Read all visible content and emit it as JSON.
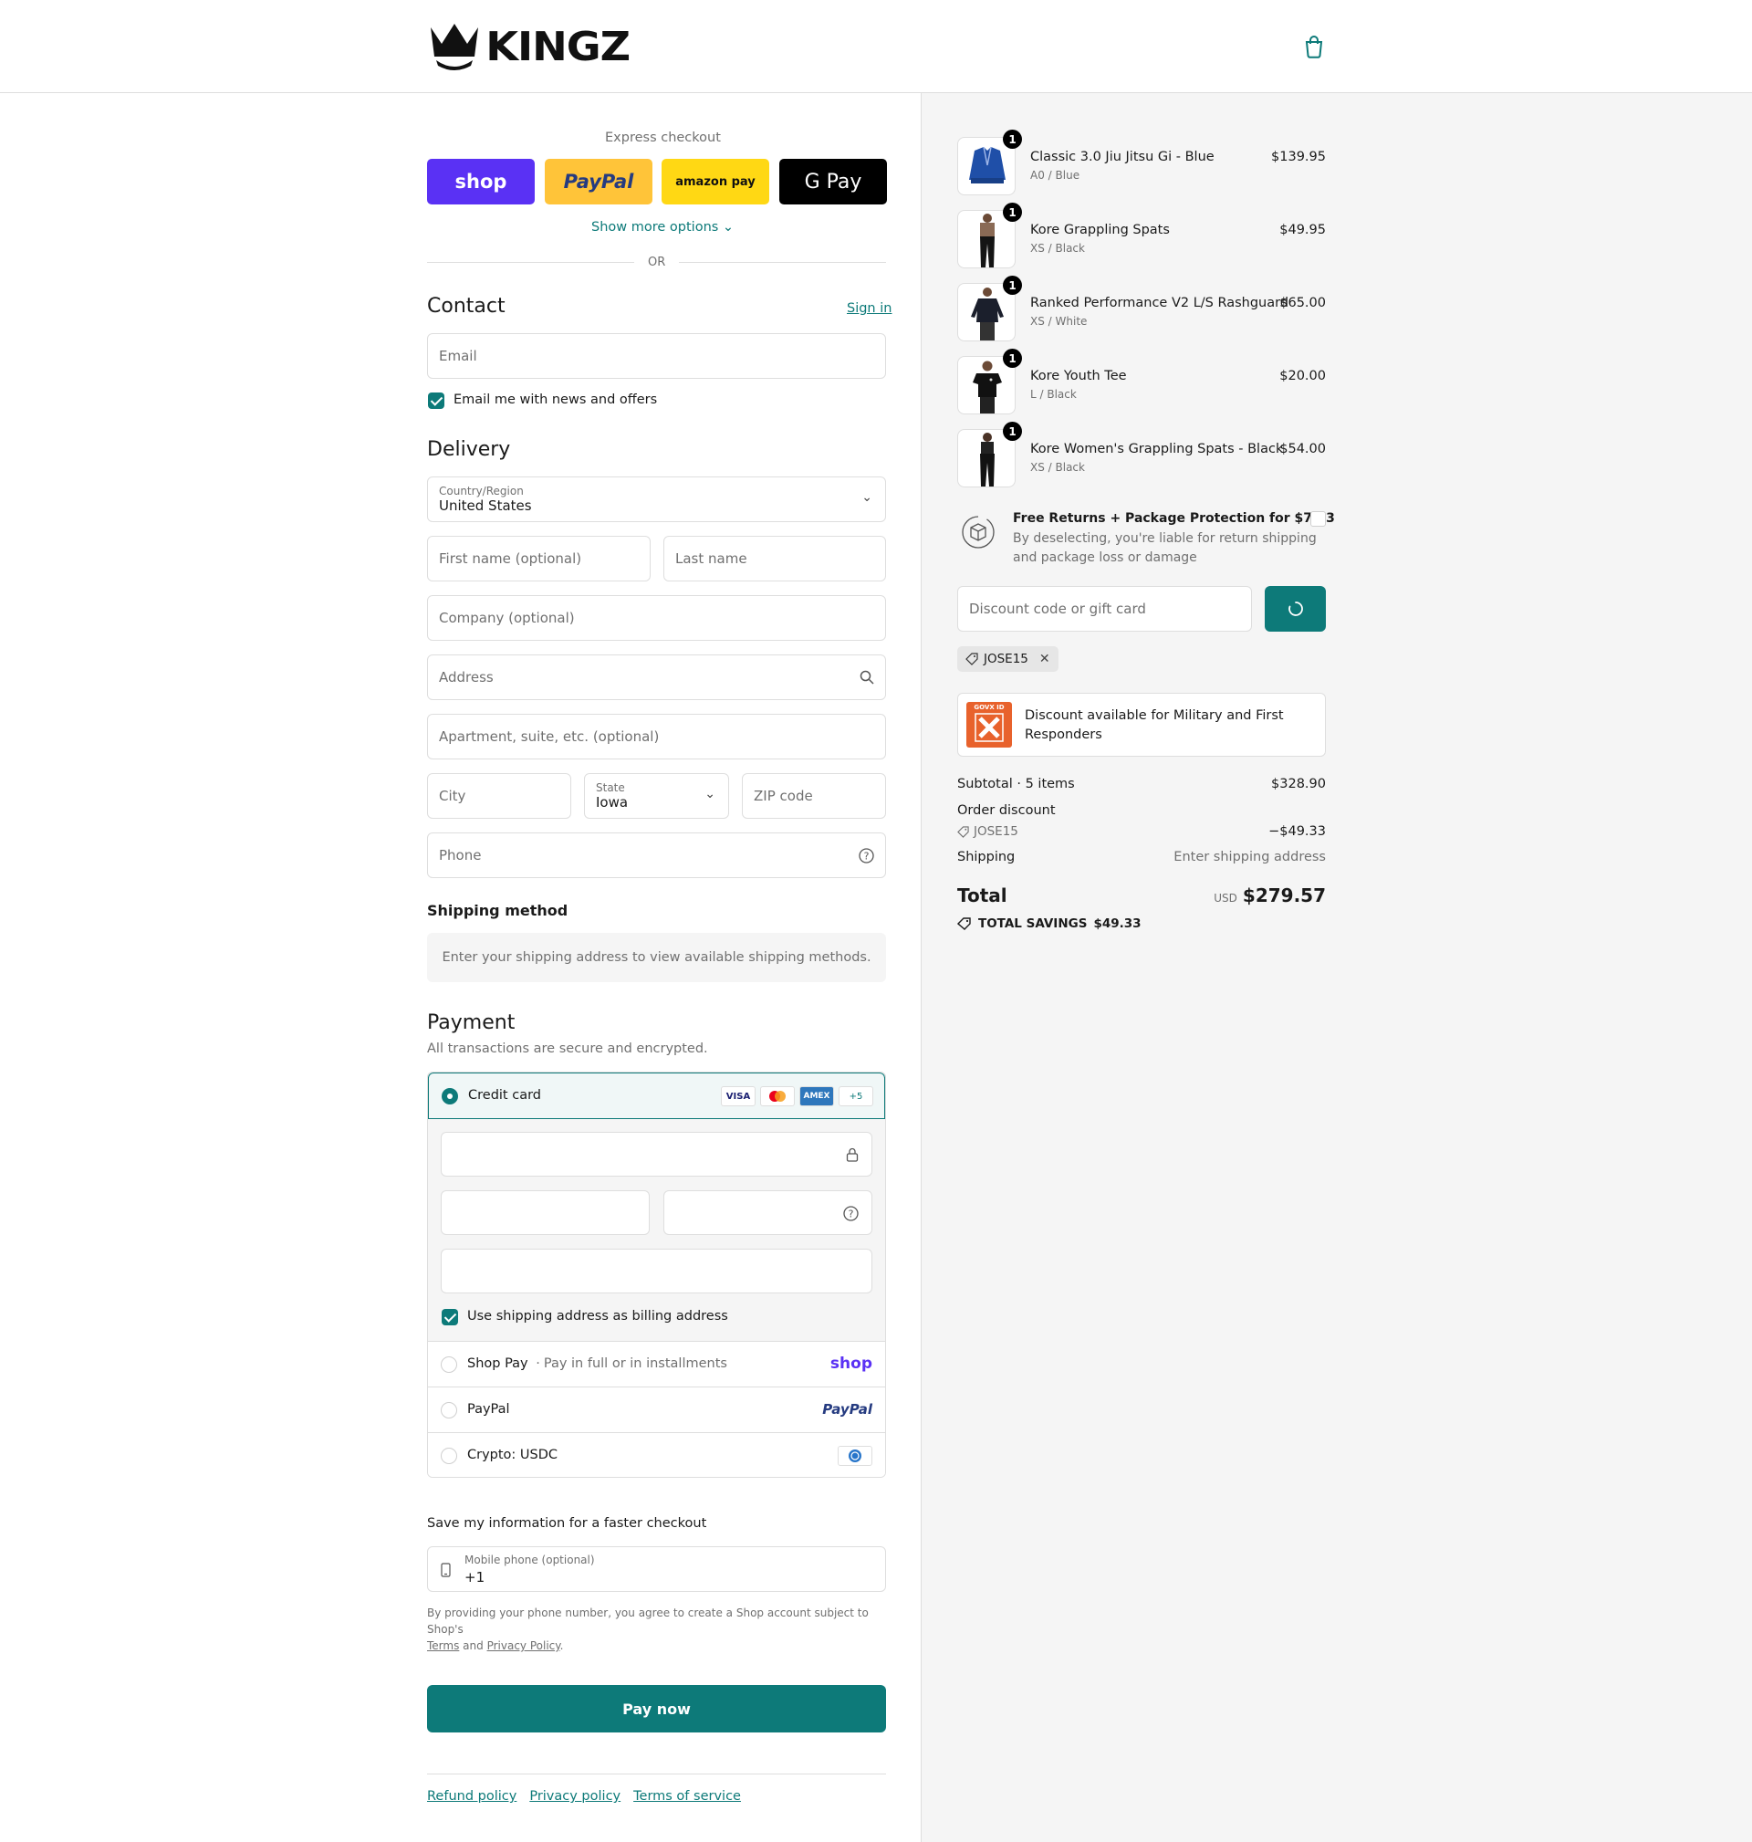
{
  "brand": {
    "name": "KINGZ"
  },
  "express": {
    "title": "Express checkout",
    "buttons": [
      "shop",
      "PayPal",
      "amazon pay",
      "G Pay"
    ],
    "more": "Show more options",
    "or": "OR"
  },
  "contact": {
    "title": "Contact",
    "signin": "Sign in",
    "email_placeholder": "Email",
    "newsletter": "Email me with news and offers"
  },
  "delivery": {
    "title": "Delivery",
    "country_label": "Country/Region",
    "country": "United States",
    "first_name": "First name (optional)",
    "last_name": "Last name",
    "company": "Company (optional)",
    "address": "Address",
    "apartment": "Apartment, suite, etc. (optional)",
    "city": "City",
    "state_label": "State",
    "state": "Iowa",
    "zip": "ZIP code",
    "phone": "Phone"
  },
  "shipping": {
    "title": "Shipping method",
    "message": "Enter your shipping address to view available shipping methods."
  },
  "payment": {
    "title": "Payment",
    "subtitle": "All transactions are secure and encrypted.",
    "credit_card": "Credit card",
    "brands": [
      "VISA",
      "Mastercard",
      "AMEX",
      "+5"
    ],
    "billing_same": "Use shipping address as billing address",
    "shop_pay": "Shop Pay",
    "shop_pay_note": "Pay in full or in installments",
    "shop_logo": "shop",
    "paypal": "PayPal",
    "paypal_logo": "PayPal",
    "crypto": "Crypto: USDC"
  },
  "save": {
    "title": "Save my information for a faster checkout",
    "phone_label": "Mobile phone (optional)",
    "phone_value": "+1",
    "legal_prefix": "By providing your phone number, you agree to create a Shop account subject to Shop's",
    "terms": "Terms",
    "and": "and",
    "privacy": "Privacy Policy",
    "period": "."
  },
  "pay_now": "Pay now",
  "footer": [
    "Refund policy",
    "Privacy policy",
    "Terms of service"
  ],
  "order": {
    "items": [
      {
        "name": "Classic 3.0 Jiu Jitsu Gi - Blue",
        "variant": "A0 / Blue",
        "price": "$139.95",
        "qty": "1"
      },
      {
        "name": "Kore Grappling Spats",
        "variant": "XS / Black",
        "price": "$49.95",
        "qty": "1"
      },
      {
        "name": "Ranked Performance V2 L/S Rashguard",
        "variant": "XS / White",
        "price": "$65.00",
        "qty": "1"
      },
      {
        "name": "Kore Youth Tee",
        "variant": "L / Black",
        "price": "$20.00",
        "qty": "1"
      },
      {
        "name": "Kore Women's Grappling Spats - Black",
        "variant": "XS / Black",
        "price": "$54.00",
        "qty": "1"
      }
    ],
    "protection_title": "Free Returns + Package Protection for $7.93",
    "protection_desc_1": "By deselecting, you're liable for return shipping",
    "protection_desc_2": "and package loss or damage",
    "discount_placeholder": "Discount code or gift card",
    "code": "JOSE15",
    "govx_badge": "GOVX ID",
    "military_1": "Discount available for Military and First",
    "military_2": "Responders",
    "subtotal_label": "Subtotal · 5 items",
    "subtotal": "$328.90",
    "order_discount": "Order discount",
    "discount_code": "JOSE15",
    "discount_value": "−$49.33",
    "shipping_label": "Shipping",
    "shipping_value": "Enter shipping address",
    "total_label": "Total",
    "currency": "USD",
    "total": "$279.57",
    "savings_label": "TOTAL SAVINGS",
    "savings": "$49.33"
  },
  "colors": {
    "accent": "#0d7a79",
    "shop": "#5a31f4",
    "paypal": "#ffc439",
    "amazon": "#ffd814"
  }
}
